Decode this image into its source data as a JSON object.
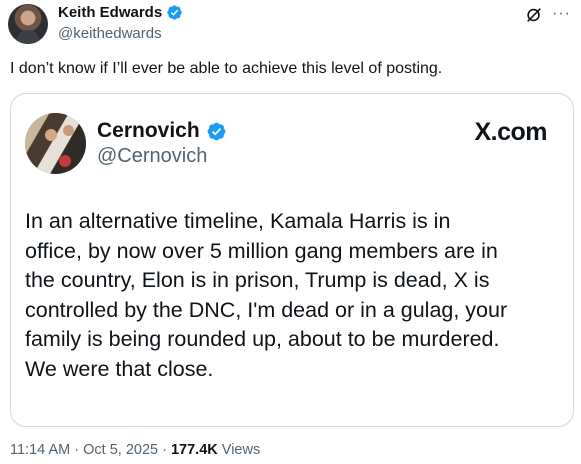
{
  "author": {
    "name": "Keith Edwards",
    "handle": "@keithedwards",
    "verified_color": "#1d9bf0"
  },
  "icons": {
    "verified": "verified-badge-icon",
    "grok": "grok-icon",
    "more": "more-dots-icon"
  },
  "more_glyph": "···",
  "post": {
    "text": "I don’t know if I’ll ever be able to achieve this level of posting."
  },
  "card": {
    "name": "Cernovich",
    "handle": "@Cernovich",
    "brand": "X.com",
    "body_lines": [
      "In an alternative timeline, Kamala Harris is in",
      "office, by now over 5 million gang members are in",
      "the country, Elon is in prison, Trump is dead, X is",
      "controlled by the DNC, I'm dead or in a gulag, your",
      "family is being rounded up, about to be murdered.",
      "We were that close."
    ]
  },
  "meta": {
    "time": "11:14 AM",
    "separator": "·",
    "date": "Oct 5, 2025",
    "views_count": "177.4K",
    "views_label": "Views"
  }
}
